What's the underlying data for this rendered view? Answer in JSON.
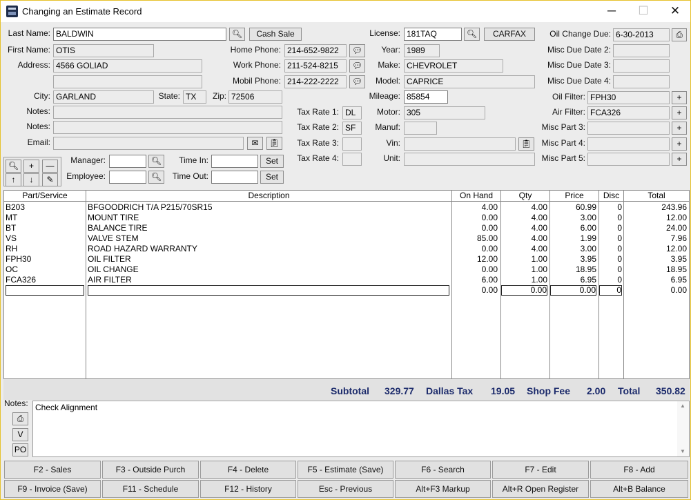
{
  "window": {
    "title": "Changing an Estimate Record",
    "minimize": "─",
    "maximize": "☐",
    "close": "✕"
  },
  "customer": {
    "last_name_label": "Last Name:",
    "last_name": "BALDWIN",
    "cash_sale": "Cash Sale",
    "first_name_label": "First Name:",
    "first_name": "OTIS",
    "address_label": "Address:",
    "address1": "4566 GOLIAD",
    "address2": "",
    "city_label": "City:",
    "city": "GARLAND",
    "state_label": "State:",
    "state": "TX",
    "zip_label": "Zip:",
    "zip": "72506",
    "notes_label": "Notes:",
    "notes1": "",
    "notes2": "",
    "email_label": "Email:",
    "email": "",
    "home_phone_label": "Home Phone:",
    "home_phone": "214-652-9822",
    "work_phone_label": "Work Phone:",
    "work_phone": "211-524-8215",
    "mobil_phone_label": "Mobil Phone:",
    "mobil_phone": "214-222-2222",
    "manager_label": "Manager:",
    "manager": "",
    "employee_label": "Employee:",
    "employee": "",
    "time_in_label": "Time In:",
    "time_in": "",
    "time_out_label": "Time Out:",
    "time_out": "",
    "set_label": "Set"
  },
  "tax": {
    "rate1_label": "Tax Rate 1:",
    "rate1": "DL",
    "rate2_label": "Tax Rate 2:",
    "rate2": "SF",
    "rate3_label": "Tax Rate 3:",
    "rate3": "",
    "rate4_label": "Tax Rate 4:",
    "rate4": ""
  },
  "vehicle": {
    "license_label": "License:",
    "license": "181TAQ",
    "carfax": "CARFAX",
    "year_label": "Year:",
    "year": "1989",
    "make_label": "Make:",
    "make": "CHEVROLET",
    "model_label": "Model:",
    "model": "CAPRICE",
    "mileage_label": "Mileage:",
    "mileage": "85854",
    "motor_label": "Motor:",
    "motor": "305",
    "manuf_label": "Manuf:",
    "manuf": "",
    "vin_label": "Vin:",
    "vin": "",
    "unit_label": "Unit:",
    "unit": ""
  },
  "service": {
    "oil_change_due_label": "Oil Change Due:",
    "oil_change_due": "6-30-2013",
    "misc_due2_label": "Misc Due Date 2:",
    "misc_due2": "",
    "misc_due3_label": "Misc Due Date 3:",
    "misc_due3": "",
    "misc_due4_label": "Misc Due Date 4:",
    "misc_due4": "",
    "oil_filter_label": "Oil Filter:",
    "oil_filter": "FPH30",
    "air_filter_label": "Air Filter:",
    "air_filter": "FCA326",
    "misc_part3_label": "Misc Part 3:",
    "misc_part3": "",
    "misc_part4_label": "Misc Part 4:",
    "misc_part4": "",
    "misc_part5_label": "Misc Part 5:",
    "misc_part5": "",
    "plus": "+"
  },
  "grid": {
    "headers": [
      "Part/Service",
      "Description",
      "On Hand",
      "Qty",
      "Price",
      "Disc",
      "Total"
    ],
    "rows": [
      [
        "B203",
        "BFGOODRICH T/A P215/70SR15",
        "4.00",
        "4.00",
        "60.99",
        "0",
        "243.96"
      ],
      [
        "MT",
        "MOUNT TIRE",
        "0.00",
        "4.00",
        "3.00",
        "0",
        "12.00"
      ],
      [
        "BT",
        "BALANCE TIRE",
        "0.00",
        "4.00",
        "6.00",
        "0",
        "24.00"
      ],
      [
        "VS",
        "VALVE STEM",
        "85.00",
        "4.00",
        "1.99",
        "0",
        "7.96"
      ],
      [
        "RH",
        "ROAD HAZARD WARRANTY",
        "0.00",
        "4.00",
        "3.00",
        "0",
        "12.00"
      ],
      [
        "FPH30",
        "OIL FILTER",
        "12.00",
        "1.00",
        "3.95",
        "0",
        "3.95"
      ],
      [
        "OC",
        "OIL CHANGE",
        "0.00",
        "1.00",
        "18.95",
        "0",
        "18.95"
      ],
      [
        "FCA326",
        "AIR FILTER",
        "6.00",
        "1.00",
        "6.95",
        "0",
        "6.95"
      ],
      [
        "",
        "",
        "0.00",
        "0.00",
        "0.00",
        "0",
        "0.00"
      ]
    ]
  },
  "totals": {
    "subtotal_label": "Subtotal",
    "subtotal": "329.77",
    "tax_label": "Dallas Tax",
    "tax": "19.05",
    "shop_fee_label": "Shop Fee",
    "shop_fee": "2.00",
    "total_label": "Total",
    "total": "350.82"
  },
  "notes": {
    "label": "Notes:",
    "text": "Check Alignment",
    "v_button": "V",
    "po_button": "PO"
  },
  "fkeys": {
    "row1": [
      "F2 - Sales",
      "F3 - Outside Purch",
      "F4 - Delete",
      "F5 - Estimate (Save)",
      "F6 - Search",
      "F7 - Edit",
      "F8 - Add"
    ],
    "row2": [
      "F9 - Invoice (Save)",
      "F11 - Schedule",
      "F12 - History",
      "Esc - Previous",
      "Alt+F3 Markup",
      "Alt+R Open Register",
      "Alt+B Balance"
    ]
  }
}
